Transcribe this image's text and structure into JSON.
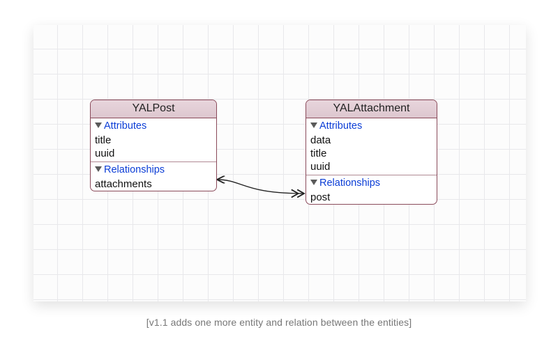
{
  "caption": "[v1.1 adds one more entity and relation between the entities]",
  "sections": {
    "attributes_label": "Attributes",
    "relationships_label": "Relationships"
  },
  "entities": {
    "post": {
      "name": "YALPost",
      "attributes": [
        "title",
        "uuid"
      ],
      "relationships": [
        "attachments"
      ]
    },
    "attachment": {
      "name": "YALAttachment",
      "attributes": [
        "data",
        "title",
        "uuid"
      ],
      "relationships": [
        "post"
      ]
    }
  },
  "relationship": {
    "from": "YALPost.attachments",
    "to": "YALAttachment.post",
    "from_cardinality": "many",
    "to_cardinality": "one"
  }
}
